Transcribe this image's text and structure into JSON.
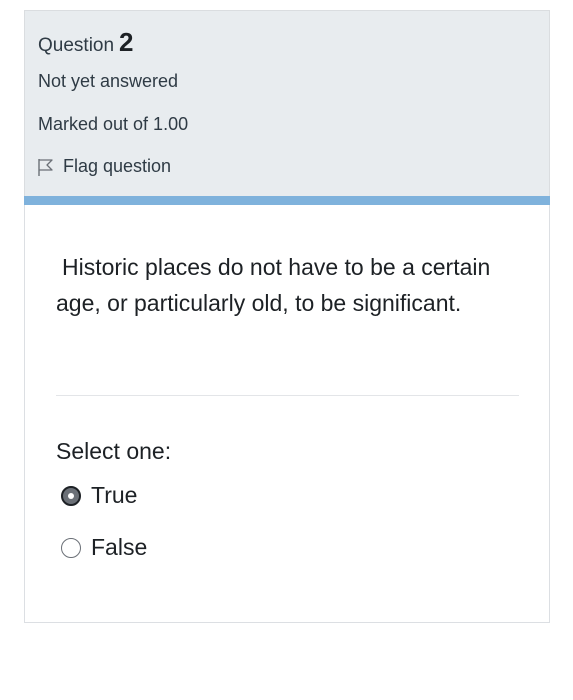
{
  "question_info": {
    "label": "Question",
    "number": "2",
    "state": "Not yet answered",
    "grade": "Marked out of 1.00",
    "flag_label": "Flag question",
    "flag_icon": "flag-outline-icon"
  },
  "question": {
    "text_line1": "Historic places do not have to be a",
    "text_rest": "certain age, or particularly old, to be significant.",
    "prompt": "Select one:",
    "options": [
      {
        "label": "True",
        "selected": true
      },
      {
        "label": "False",
        "selected": false
      }
    ]
  },
  "colors": {
    "info_background": "#e8ecef",
    "accent_bar": "#7fb2dc",
    "text": "#1d2125"
  }
}
